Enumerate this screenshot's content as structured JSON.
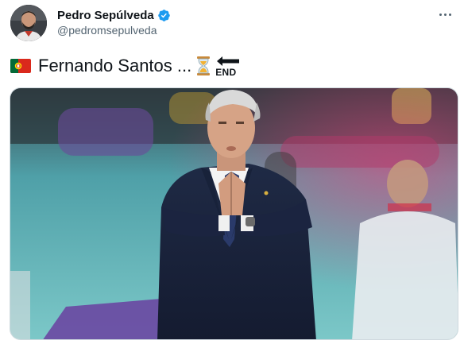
{
  "author": {
    "display_name": "Pedro Sepúlveda",
    "handle": "@pedromsepulveda",
    "verified": true
  },
  "tweet": {
    "text": "Fernando Santos ...",
    "emoji_prefix": "portugal-flag",
    "emoji_suffix": [
      "hourglass-emoji",
      "end-arrow-emoji"
    ],
    "end_label": "END"
  },
  "colors": {
    "verified_blue": "#1d9bf0",
    "handle_gray": "#536471",
    "text": "#0f1419"
  }
}
